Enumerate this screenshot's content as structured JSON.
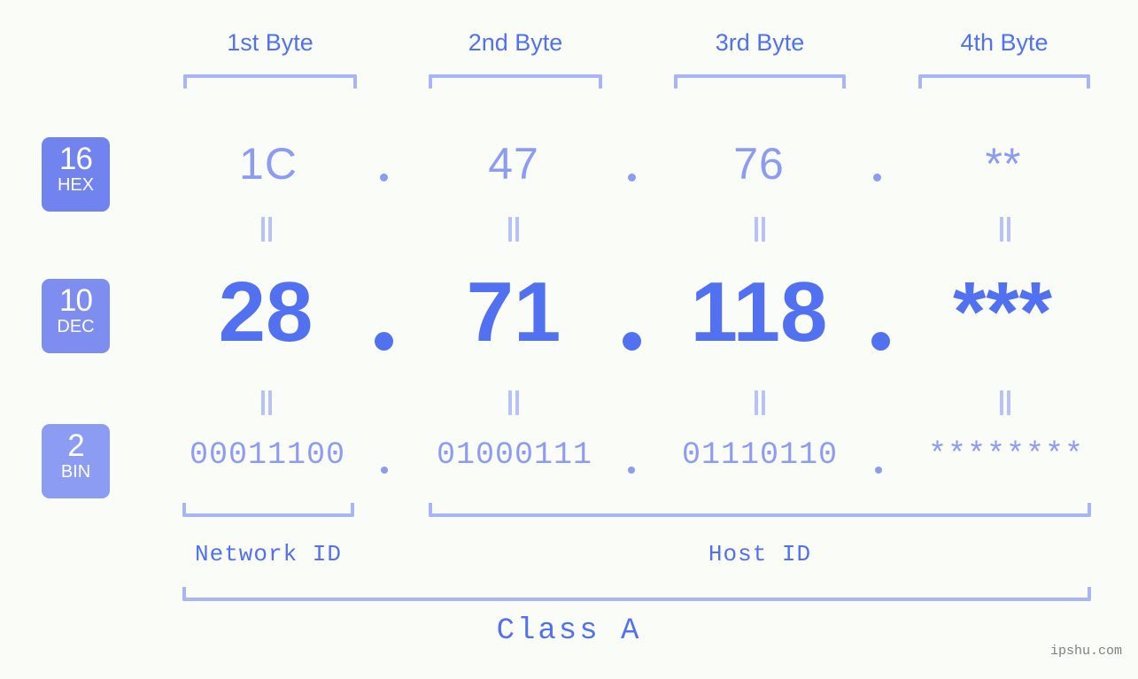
{
  "page": {
    "background_color": "#fafcf8",
    "accent_color": "#5271f0",
    "light_accent_color": "#8c9cf2",
    "bracket_color": "#aab5f7",
    "watermark": "ipshu.com"
  },
  "byte_headers": [
    {
      "label": "1st Byte"
    },
    {
      "label": "2nd Byte"
    },
    {
      "label": "3rd Byte"
    },
    {
      "label": "4th Byte"
    }
  ],
  "bases": [
    {
      "id": "hex",
      "number": "16",
      "name": "HEX",
      "badge_color": "#7183ee"
    },
    {
      "id": "dec",
      "number": "10",
      "name": "DEC",
      "badge_color": "#7e8df0"
    },
    {
      "id": "bin",
      "number": "2",
      "name": "BIN",
      "badge_color": "#8c9cf2"
    }
  ],
  "rows": {
    "hex": {
      "bytes": [
        "1C",
        "47",
        "76",
        "**"
      ],
      "separator": "."
    },
    "dec": {
      "bytes": [
        "28",
        "71",
        "118",
        "***"
      ],
      "separator": "."
    },
    "bin": {
      "bytes": [
        "00011100",
        "01000111",
        "01110110",
        "********"
      ],
      "separator": "."
    }
  },
  "equals_connectors": {
    "glyph": "||",
    "count_per_row": 4
  },
  "segments": {
    "network_id": {
      "label": "Network ID"
    },
    "host_id": {
      "label": "Host ID"
    }
  },
  "class": {
    "label": "Class A"
  }
}
